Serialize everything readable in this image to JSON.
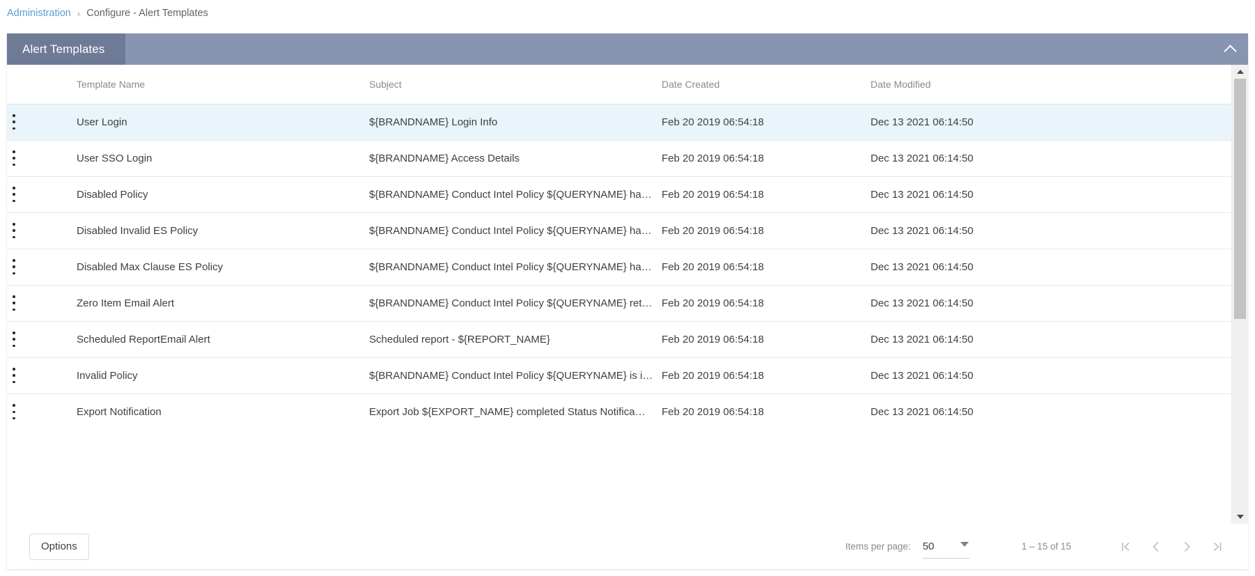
{
  "breadcrumb": {
    "root": "Administration",
    "separator": "›",
    "current": "Configure - Alert Templates"
  },
  "card": {
    "title": "Alert Templates",
    "collapse_icon": "chevron-up-icon"
  },
  "table": {
    "columns": [
      "Template Name",
      "Subject",
      "Date Created",
      "Date Modified"
    ],
    "row_menu_icon": "more-vertical-icon",
    "rows": [
      {
        "name": "User Login",
        "subject": "${BRANDNAME} Login Info",
        "created": "Feb 20 2019 06:54:18",
        "modified": "Dec 13 2021 06:14:50",
        "selected": true
      },
      {
        "name": "User SSO Login",
        "subject": "${BRANDNAME} Access Details",
        "created": "Feb 20 2019 06:54:18",
        "modified": "Dec 13 2021 06:14:50",
        "selected": false
      },
      {
        "name": "Disabled Policy",
        "subject": "${BRANDNAME} Conduct Intel Policy ${QUERYNAME} ha…",
        "created": "Feb 20 2019 06:54:18",
        "modified": "Dec 13 2021 06:14:50",
        "selected": false
      },
      {
        "name": "Disabled Invalid ES Policy",
        "subject": "${BRANDNAME} Conduct Intel Policy ${QUERYNAME} ha…",
        "created": "Feb 20 2019 06:54:18",
        "modified": "Dec 13 2021 06:14:50",
        "selected": false
      },
      {
        "name": "Disabled Max Clause ES Policy",
        "subject": "${BRANDNAME} Conduct Intel Policy ${QUERYNAME} ha…",
        "created": "Feb 20 2019 06:54:18",
        "modified": "Dec 13 2021 06:14:50",
        "selected": false
      },
      {
        "name": "Zero Item Email Alert",
        "subject": "${BRANDNAME} Conduct Intel Policy ${QUERYNAME} ret…",
        "created": "Feb 20 2019 06:54:18",
        "modified": "Dec 13 2021 06:14:50",
        "selected": false
      },
      {
        "name": "Scheduled ReportEmail Alert",
        "subject": "Scheduled report - ${REPORT_NAME}",
        "created": "Feb 20 2019 06:54:18",
        "modified": "Dec 13 2021 06:14:50",
        "selected": false
      },
      {
        "name": "Invalid Policy",
        "subject": "${BRANDNAME} Conduct Intel Policy ${QUERYNAME} is i…",
        "created": "Feb 20 2019 06:54:18",
        "modified": "Dec 13 2021 06:14:50",
        "selected": false
      },
      {
        "name": "Export Notification",
        "subject": "Export Job ${EXPORT_NAME} completed Status Notifica…",
        "created": "Feb 20 2019 06:54:18",
        "modified": "Dec 13 2021 06:14:50",
        "selected": false
      }
    ]
  },
  "footer": {
    "options_label": "Options",
    "items_per_page_label": "Items per page:",
    "items_per_page_value": "50",
    "range_label": "1 – 15 of 15",
    "first_page_icon": "first-page-icon",
    "prev_page_icon": "chevron-left-icon",
    "next_page_icon": "chevron-right-icon",
    "last_page_icon": "last-page-icon"
  },
  "scrollbar": {
    "up_arrow_icon": "caret-up-icon",
    "down_arrow_icon": "caret-down-icon"
  },
  "colors": {
    "header_bar": "#8795b0",
    "header_tab": "#6e7b96",
    "link": "#5b9bd5",
    "selected_row": "#eaf5fb"
  }
}
